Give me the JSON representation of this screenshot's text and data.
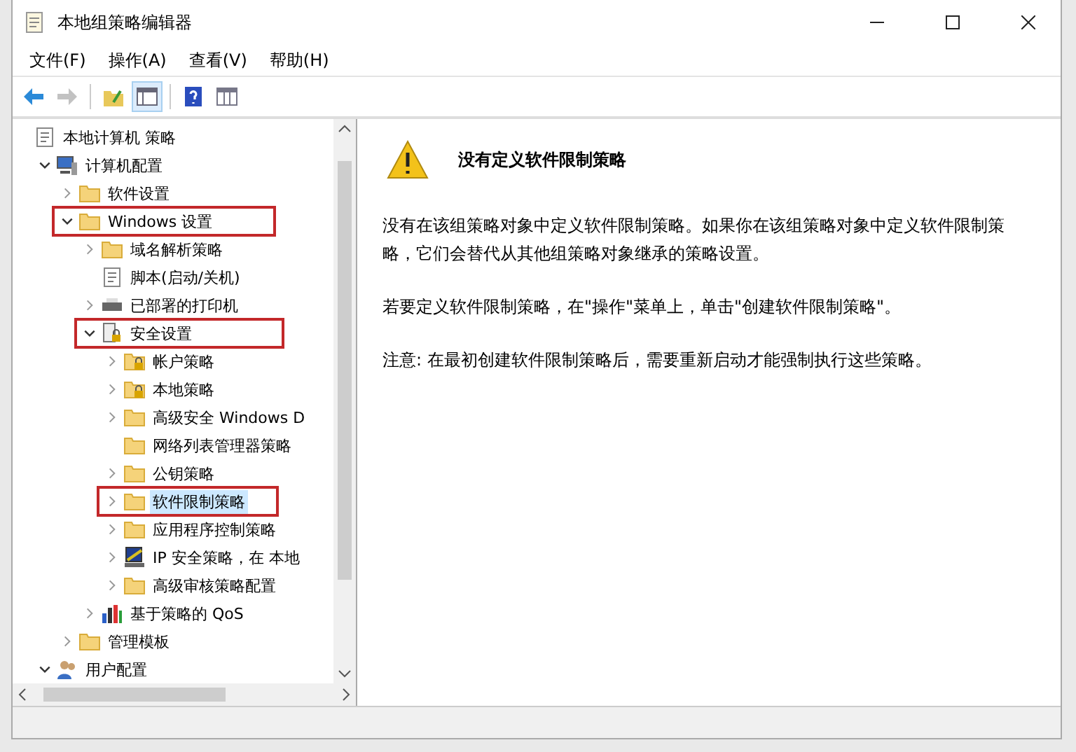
{
  "window": {
    "title": "本地组策略编辑器"
  },
  "menu": [
    "文件(F)",
    "操作(A)",
    "查看(V)",
    "帮助(H)"
  ],
  "toolbar": [
    {
      "kind": "back",
      "disabled": false
    },
    {
      "kind": "forward",
      "disabled": true
    },
    {
      "kind": "up",
      "disabled": false
    },
    {
      "kind": "tree",
      "disabled": false
    },
    {
      "kind": "help",
      "disabled": false
    },
    {
      "kind": "props",
      "disabled": false
    }
  ],
  "tree": [
    {
      "label": "本地计算机 策略",
      "kind": "doc",
      "selected": false,
      "highlighted": false,
      "children": [
        {
          "label": "计算机配置",
          "kind": "computer",
          "expanded": true,
          "selected": false,
          "highlighted": false,
          "children": [
            {
              "label": "软件设置",
              "kind": "folder",
              "expanded": false,
              "selected": false,
              "highlighted": false
            },
            {
              "label": "Windows 设置",
              "kind": "folder",
              "expanded": true,
              "selected": false,
              "highlighted": true,
              "children": [
                {
                  "label": "域名解析策略",
                  "kind": "folder",
                  "expanded": false,
                  "selected": false,
                  "highlighted": false
                },
                {
                  "label": "脚本(启动/关机)",
                  "kind": "script",
                  "selected": false,
                  "highlighted": false
                },
                {
                  "label": "已部署的打印机",
                  "kind": "printer",
                  "expanded": false,
                  "selected": false,
                  "highlighted": false
                },
                {
                  "label": "安全设置",
                  "kind": "security",
                  "expanded": true,
                  "selected": false,
                  "highlighted": true,
                  "children": [
                    {
                      "label": "帐户策略",
                      "kind": "lockfolder",
                      "expanded": false,
                      "selected": false,
                      "highlighted": false
                    },
                    {
                      "label": "本地策略",
                      "kind": "lockfolder",
                      "expanded": false,
                      "selected": false,
                      "highlighted": false
                    },
                    {
                      "label": "高级安全 Windows D",
                      "kind": "folder",
                      "expanded": false,
                      "selected": false,
                      "highlighted": false
                    },
                    {
                      "label": "网络列表管理器策略",
                      "kind": "folder",
                      "selected": false,
                      "highlighted": false
                    },
                    {
                      "label": "公钥策略",
                      "kind": "folder",
                      "expanded": false,
                      "selected": false,
                      "highlighted": false
                    },
                    {
                      "label": "软件限制策略",
                      "kind": "folder",
                      "expanded": false,
                      "selected": true,
                      "highlighted": true
                    },
                    {
                      "label": "应用程序控制策略",
                      "kind": "folder",
                      "expanded": false,
                      "selected": false,
                      "highlighted": false
                    },
                    {
                      "label": "IP 安全策略，在 本地",
                      "kind": "netcomputer",
                      "expanded": false,
                      "selected": false,
                      "highlighted": false
                    },
                    {
                      "label": "高级审核策略配置",
                      "kind": "folder",
                      "expanded": false,
                      "selected": false,
                      "highlighted": false
                    }
                  ]
                },
                {
                  "label": "基于策略的 QoS",
                  "kind": "chart",
                  "expanded": false,
                  "selected": false,
                  "highlighted": false
                }
              ]
            },
            {
              "label": "管理模板",
              "kind": "folder",
              "expanded": false,
              "selected": false,
              "highlighted": false
            }
          ]
        },
        {
          "label": "用户配置",
          "kind": "user",
          "expanded": true,
          "selected": false,
          "highlighted": false
        }
      ]
    }
  ],
  "content": {
    "heading": "没有定义软件限制策略",
    "paragraphs": [
      "没有在该组策略对象中定义软件限制策略。如果你在该组策略对象中定义软件限制策略，它们会替代从其他组策略对象继承的策略设置。",
      "若要定义软件限制策略，在\"操作\"菜单上，单击\"创建软件限制策略\"。",
      "注意: 在最初创建软件限制策略后，需要重新启动才能强制执行这些策略。"
    ]
  }
}
